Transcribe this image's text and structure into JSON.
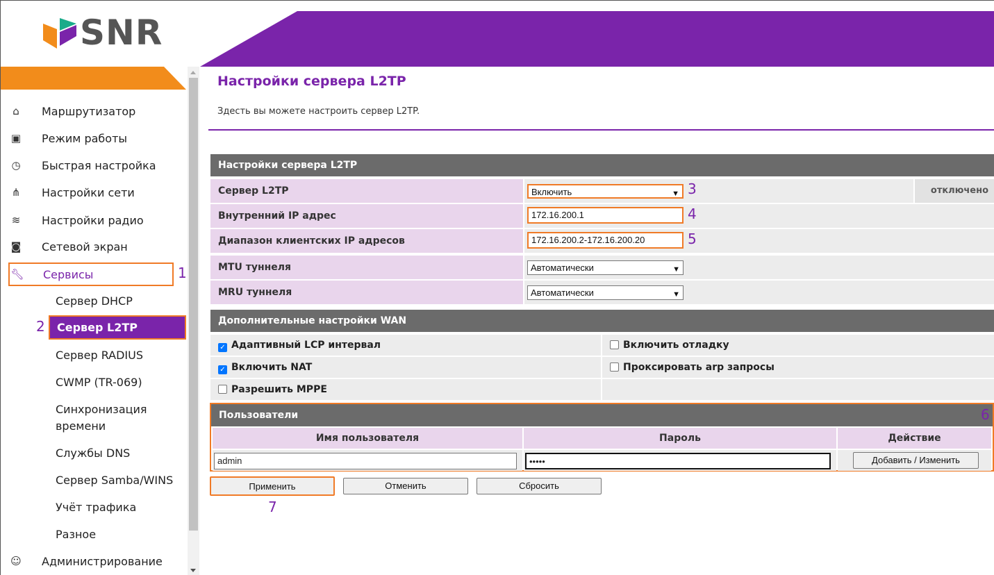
{
  "brand": {
    "name": "SNR",
    "accent": "#7a24aa",
    "highlight": "#f07a26",
    "bar": "#f28c1b"
  },
  "sidebar": {
    "items": [
      {
        "label": "Маршрутизатор",
        "icon": "router-icon"
      },
      {
        "label": "Режим работы",
        "icon": "mode-icon"
      },
      {
        "label": "Быстрая настройка",
        "icon": "stopwatch-icon"
      },
      {
        "label": "Настройки сети",
        "icon": "network-icon"
      },
      {
        "label": "Настройки радио",
        "icon": "wifi-icon"
      },
      {
        "label": "Сетевой экран",
        "icon": "firewall-icon"
      },
      {
        "label": "Сервисы",
        "icon": "wrench-icon"
      },
      {
        "label": "Администрирование",
        "icon": "admin-icon"
      }
    ],
    "sub_items": [
      "Сервер DHCP",
      "Сервер L2TP",
      "Сервер RADIUS",
      "CWMP (TR-069)",
      "Синхронизация времени",
      "Службы DNS",
      "Сервер Samba/WINS",
      "Учёт трафика",
      "Разное"
    ]
  },
  "annotations": {
    "a1": "1",
    "a2": "2",
    "a3": "3",
    "a4": "4",
    "a5": "5",
    "a6": "6",
    "a7": "7"
  },
  "page": {
    "title": "Настройки сервера L2TP",
    "description": "Здесть вы можете настроить сервер L2TP."
  },
  "settings": {
    "header": "Настройки сервера L2TP",
    "server_label": "Сервер L2TP",
    "server_value": "Включить",
    "server_status": "отключено",
    "ip_label": "Внутренний IP адрес",
    "ip_value": "172.16.200.1",
    "range_label": "Диапазон клиентских IP адресов",
    "range_value": "172.16.200.2-172.16.200.20",
    "mtu_label": "MTU туннеля",
    "mtu_value": "Автоматически",
    "mru_label": "MRU туннеля",
    "mru_value": "Автоматически"
  },
  "wan": {
    "header": "Дополнительные настройки WAN",
    "adaptive_lcp": "Адаптивный LCP интервал",
    "debug": "Включить отладку",
    "nat": "Включить NAT",
    "proxy_arp": "Проксировать arp запросы",
    "mppe": "Разрешить MPPE"
  },
  "users": {
    "header": "Пользователи",
    "col_name": "Имя пользователя",
    "col_password": "Пароль",
    "col_action": "Действие",
    "name_value": "admin",
    "password_value": "•••••",
    "add_button": "Добавить / Изменить"
  },
  "buttons": {
    "apply": "Применить",
    "cancel": "Отменить",
    "reset": "Сбросить"
  }
}
